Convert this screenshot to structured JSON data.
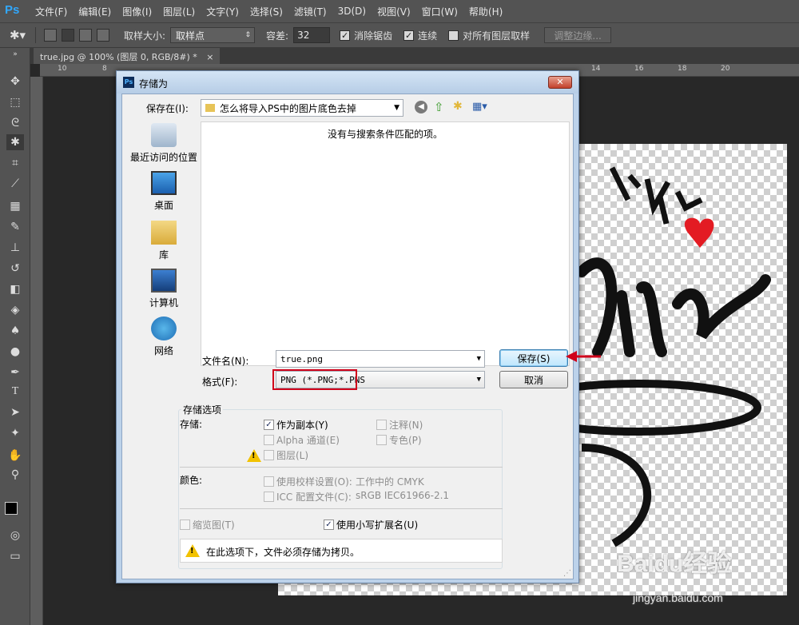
{
  "app": {
    "logo": "Ps",
    "menu": [
      "文件(F)",
      "编辑(E)",
      "图像(I)",
      "图层(L)",
      "文字(Y)",
      "选择(S)",
      "滤镜(T)",
      "3D(D)",
      "视图(V)",
      "窗口(W)",
      "帮助(H)"
    ]
  },
  "options": {
    "sample_size_label": "取样大小:",
    "sample_size_value": "取样点",
    "tolerance_label": "容差:",
    "tolerance_value": "32",
    "antialias_label": "消除锯齿",
    "contiguous_label": "连续",
    "all_layers_label": "对所有图层取样",
    "refine_edge_label": "调整边缘..."
  },
  "document": {
    "tab_title": "true.jpg @ 100% (图层 0, RGB/8#) *",
    "ruler_h": [
      "10",
      "8",
      "14",
      "16",
      "18",
      "20"
    ],
    "ruler_h_right": [
      "14",
      "16",
      "18",
      "20"
    ]
  },
  "dialog": {
    "title": "存储为",
    "save_in_label": "保存在(I):",
    "save_in_value": "怎么将导入PS中的图片底色去掉",
    "empty_message": "没有与搜索条件匹配的项。",
    "places": [
      "最近访问的位置",
      "桌面",
      "库",
      "计算机",
      "网络"
    ],
    "filename_label": "文件名(N):",
    "filename_value": "true.png",
    "format_label": "格式(F):",
    "format_value": "PNG (*.PNG;*.PNS",
    "save_button": "保存(S)",
    "cancel_button": "取消",
    "options_group": "存储选项",
    "store_label": "存储:",
    "as_copy": "作为副本(Y)",
    "notes": "注释(N)",
    "alpha": "Alpha 通道(E)",
    "spot": "专色(P)",
    "layers": "图层(L)",
    "color_label": "颜色:",
    "proof": "使用校样设置(O):",
    "proof_value": "工作中的 CMYK",
    "icc": "ICC 配置文件(C):",
    "icc_value": "sRGB IEC61966-2.1",
    "thumbnail": "缩览图(T)",
    "lowercase_ext": "使用小写扩展名(U)",
    "warning": "在此选项下，文件必须存储为拷贝。"
  },
  "watermark": {
    "text1": "Baidu经验",
    "text2": "jingyan.baidu.com"
  },
  "colors": {
    "highlight_red": "#d0021b",
    "ps_blue": "#31a8ff"
  }
}
